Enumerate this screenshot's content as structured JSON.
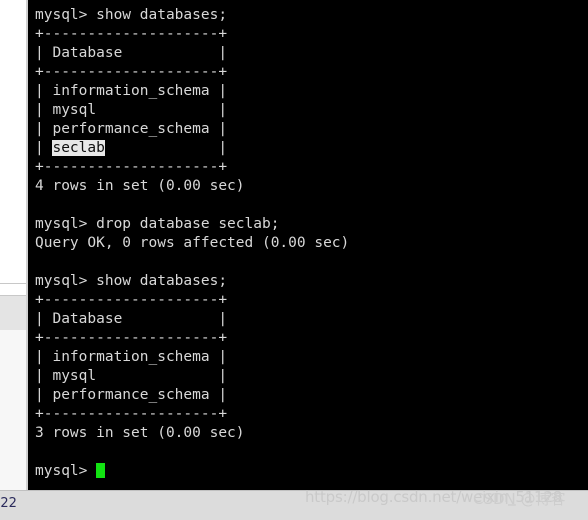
{
  "terminal": {
    "lines": [
      {
        "id": "cmd-show-databases-1",
        "text": "mysql> show databases;"
      },
      {
        "id": "table1-top-border",
        "text": "+--------------------+"
      },
      {
        "id": "table1-header",
        "text": "| Database           |"
      },
      {
        "id": "table1-header-border",
        "text": "+--------------------+"
      },
      {
        "id": "table1-row-information-schema",
        "text": "| information_schema |"
      },
      {
        "id": "table1-row-mysql",
        "text": "| mysql              |"
      },
      {
        "id": "table1-row-performance-schema",
        "text": "| performance_schema |"
      },
      {
        "id": "table1-row-seclab",
        "text": "| seclab             |",
        "selection": {
          "prefix": "| ",
          "highlighted": "seclab",
          "suffix": "             |"
        }
      },
      {
        "id": "table1-bottom-border",
        "text": "+--------------------+"
      },
      {
        "id": "result1-rows",
        "text": "4 rows in set (0.00 sec)"
      },
      {
        "id": "blank-1",
        "text": ""
      },
      {
        "id": "cmd-drop-database",
        "text": "mysql> drop database seclab;"
      },
      {
        "id": "result-query-ok",
        "text": "Query OK, 0 rows affected (0.00 sec)"
      },
      {
        "id": "blank-2",
        "text": ""
      },
      {
        "id": "cmd-show-databases-2",
        "text": "mysql> show databases;"
      },
      {
        "id": "table2-top-border",
        "text": "+--------------------+"
      },
      {
        "id": "table2-header",
        "text": "| Database           |"
      },
      {
        "id": "table2-header-border",
        "text": "+--------------------+"
      },
      {
        "id": "table2-row-information-schema",
        "text": "| information_schema |"
      },
      {
        "id": "table2-row-mysql",
        "text": "| mysql              |"
      },
      {
        "id": "table2-row-performance-schema",
        "text": "| performance_schema |"
      },
      {
        "id": "table2-bottom-border",
        "text": "+--------------------+"
      },
      {
        "id": "result2-rows",
        "text": "3 rows in set (0.00 sec)"
      },
      {
        "id": "blank-3",
        "text": ""
      }
    ],
    "prompt": "mysql> ",
    "colors": {
      "background": "#000000",
      "foreground": "#d8d8d8",
      "cursor": "#12e312",
      "selection_background": "#e8e8e8",
      "selection_foreground": "#101010"
    }
  },
  "statusbar": {
    "text": ":22"
  },
  "watermark": {
    "url": "https://blog.csdn.net/weixin_51128",
    "overlay": "CSDN @博客"
  }
}
